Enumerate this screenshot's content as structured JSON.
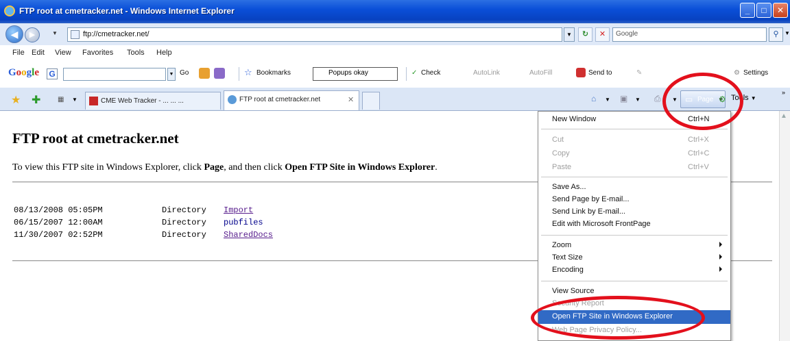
{
  "window": {
    "title": "FTP root at cmetracker.net - Windows Internet Explorer"
  },
  "address_bar": {
    "url": "ftp://cmetracker.net/",
    "search_placeholder": "Google"
  },
  "menubar": {
    "items": [
      "File",
      "Edit",
      "View",
      "Favorites",
      "Tools",
      "Help"
    ]
  },
  "google_toolbar": {
    "logo": {
      "b": "G",
      "r": "o",
      "y": "o",
      "g": "g",
      "b2": "l",
      "r2": "e"
    },
    "g_icon": "G",
    "go": "Go",
    "bookmarks": "Bookmarks",
    "popups": "Popups okay",
    "check": "Check",
    "autolink": "AutoLink",
    "autofill": "AutoFill",
    "sendto": "Send to",
    "settings": "Settings"
  },
  "tabs": [
    {
      "label": "CME Web Tracker - ... ... ..."
    },
    {
      "label": "FTP root at cmetracker.net"
    }
  ],
  "commandbar": {
    "page": "Page",
    "tools": "Tools"
  },
  "content": {
    "title": "FTP root at cmetracker.net",
    "instructions": {
      "part1": "To view this FTP site in Windows Explorer, click ",
      "page": "Page",
      "part2": ", and then click ",
      "open": "Open FTP Site in Windows Explorer",
      "part3": "."
    },
    "listing": [
      {
        "date": "08/13/2008 05:05PM",
        "type": "Directory",
        "name": "Import"
      },
      {
        "date": "06/15/2007 12:00AM",
        "type": "Directory",
        "name": "pubfiles"
      },
      {
        "date": "11/30/2007 02:52PM",
        "type": "Directory",
        "name": "SharedDocs"
      }
    ]
  },
  "page_menu": {
    "new_window": {
      "label": "New Window",
      "shortcut": "Ctrl+N"
    },
    "cut": {
      "label": "Cut",
      "shortcut": "Ctrl+X"
    },
    "copy": {
      "label": "Copy",
      "shortcut": "Ctrl+C"
    },
    "paste": {
      "label": "Paste",
      "shortcut": "Ctrl+V"
    },
    "save_as": "Save As...",
    "send_page": "Send Page by E-mail...",
    "send_link": "Send Link by E-mail...",
    "edit_with": "Edit with Microsoft FrontPage",
    "zoom": "Zoom",
    "text_size": "Text Size",
    "encoding": "Encoding",
    "view_source": "View Source",
    "security_report": "Security Report",
    "open_ftp": "Open FTP Site in Windows Explorer",
    "privacy_policy": "Web Page Privacy Policy..."
  },
  "colors": {
    "highlight_ring": "#e3101c",
    "menu_selection": "#316ac5",
    "visited_link": "#551a8b"
  }
}
